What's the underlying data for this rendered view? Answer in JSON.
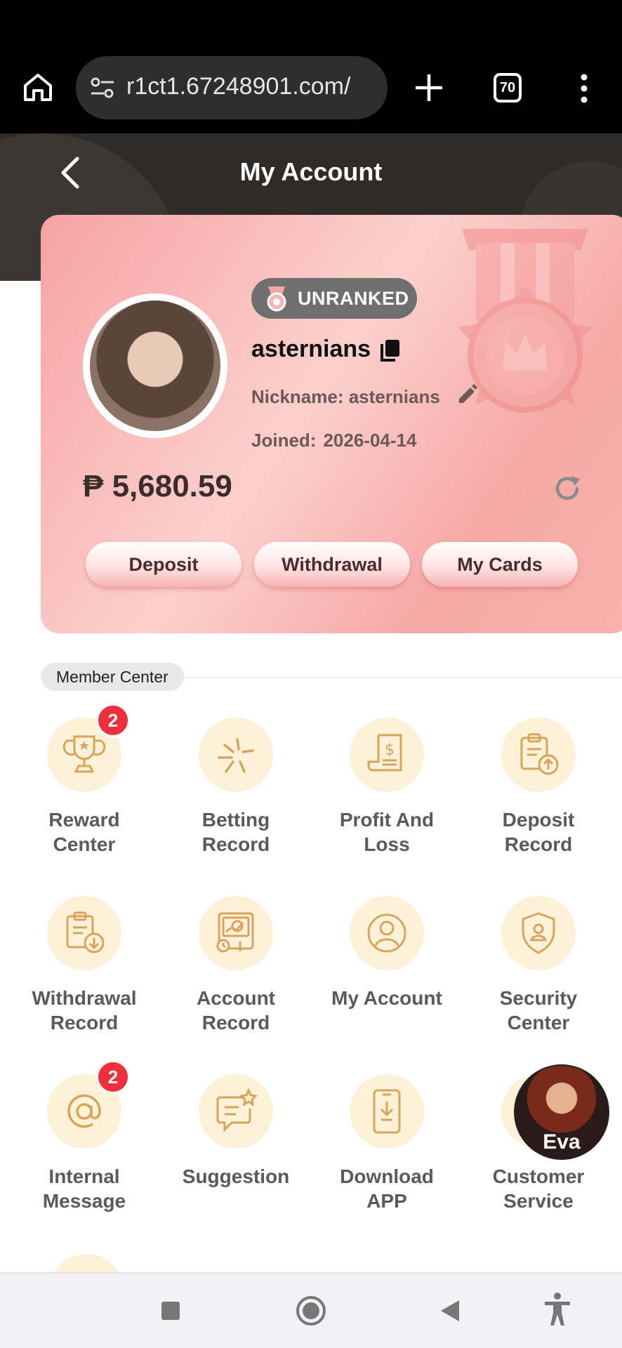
{
  "browser": {
    "url": "r1ct1.67248901.com/",
    "tab_count": "70"
  },
  "header": {
    "title": "My Account"
  },
  "profile": {
    "rank": "UNRANKED",
    "username": "asternians",
    "nickname": "Nickname: asternians",
    "joined_label": "Joined:",
    "joined_date": "2026-04-14",
    "balance": "₱ 5,680.59",
    "buttons": {
      "deposit": "Deposit",
      "withdrawal": "Withdrawal",
      "my_cards": "My Cards"
    }
  },
  "member_center": {
    "title": "Member Center",
    "items": [
      {
        "label_line1": "Reward",
        "label_line2": "Center",
        "icon": "trophy-icon",
        "badge": "2"
      },
      {
        "label_line1": "Betting",
        "label_line2": "Record",
        "icon": "betting-icon"
      },
      {
        "label_line1": "Profit And",
        "label_line2": "Loss",
        "icon": "profit-receipt-icon"
      },
      {
        "label_line1": "Deposit",
        "label_line2": "Record",
        "icon": "deposit-clipboard-icon"
      },
      {
        "label_line1": "Withdrawal",
        "label_line2": "Record",
        "icon": "withdrawal-clipboard-icon"
      },
      {
        "label_line1": "Account",
        "label_line2": "Record",
        "icon": "account-record-icon"
      },
      {
        "label_line1": "My Account",
        "label_line2": "",
        "icon": "user-icon"
      },
      {
        "label_line1": "Security",
        "label_line2": "Center",
        "icon": "shield-icon"
      },
      {
        "label_line1": "Internal",
        "label_line2": "Message",
        "icon": "at-sign-icon",
        "badge": "2"
      },
      {
        "label_line1": "Suggestion",
        "label_line2": "",
        "icon": "suggestion-icon"
      },
      {
        "label_line1": "Download",
        "label_line2": "APP",
        "icon": "download-phone-icon"
      },
      {
        "label_line1": "Customer",
        "label_line2": "Service",
        "icon": "headset-icon"
      }
    ]
  },
  "support_agent": {
    "name": "Eva"
  },
  "theme": {
    "accent": "#d8a85c",
    "card_pink": "#f6a3a3",
    "badge_red": "#ef2f3c",
    "header_dark": "#2f2b29"
  }
}
